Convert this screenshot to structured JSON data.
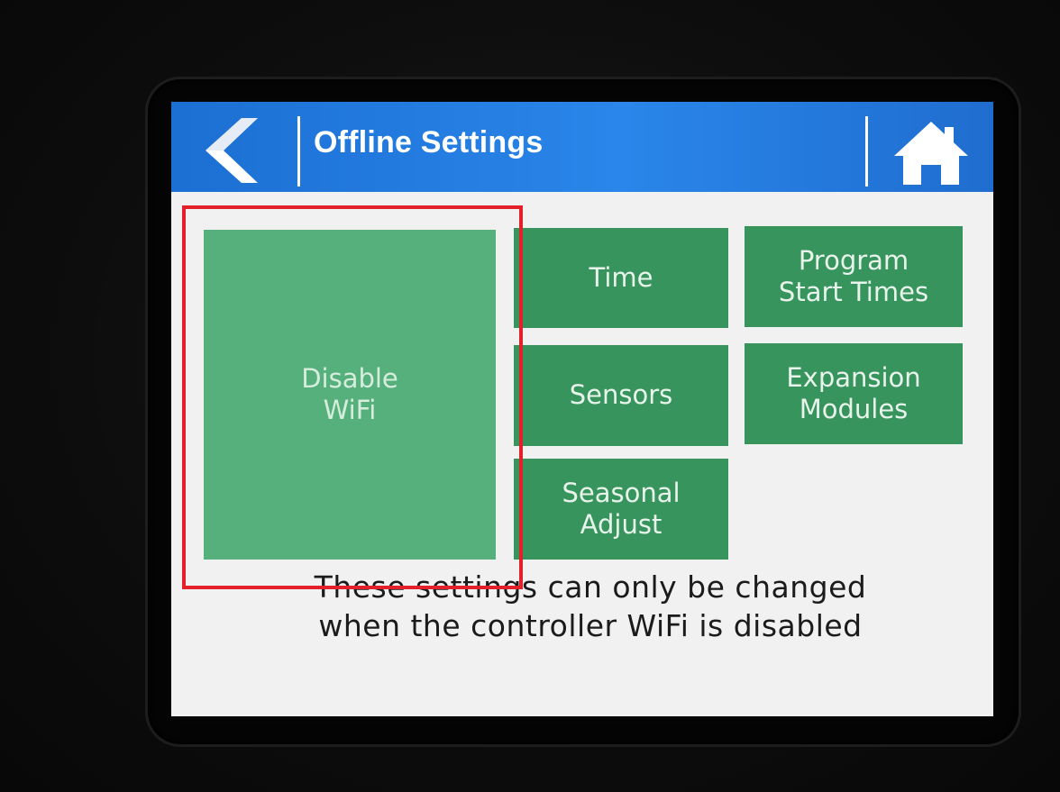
{
  "header": {
    "title": "Offline Settings",
    "back_icon": "chevron-left-icon",
    "home_icon": "home-icon",
    "color": "#2a86ea"
  },
  "tiles": [
    {
      "id": "disable-wifi",
      "label": "Disable\nWiFi",
      "color": "#56b07c"
    },
    {
      "id": "time",
      "label": "Time",
      "color": "#37945d"
    },
    {
      "id": "program-start-times",
      "label": "Program\nStart Times",
      "color": "#37945d"
    },
    {
      "id": "sensors",
      "label": "Sensors",
      "color": "#37945d"
    },
    {
      "id": "expansion-modules",
      "label": "Expansion\nModules",
      "color": "#37945d"
    },
    {
      "id": "seasonal-adjust",
      "label": "Seasonal\nAdjust",
      "color": "#37945d"
    }
  ],
  "notice": {
    "line1": "These settings can only be changed",
    "line2": "when the controller WiFi is disabled"
  },
  "highlight": {
    "target": "disable-wifi",
    "color": "#e4202a"
  }
}
